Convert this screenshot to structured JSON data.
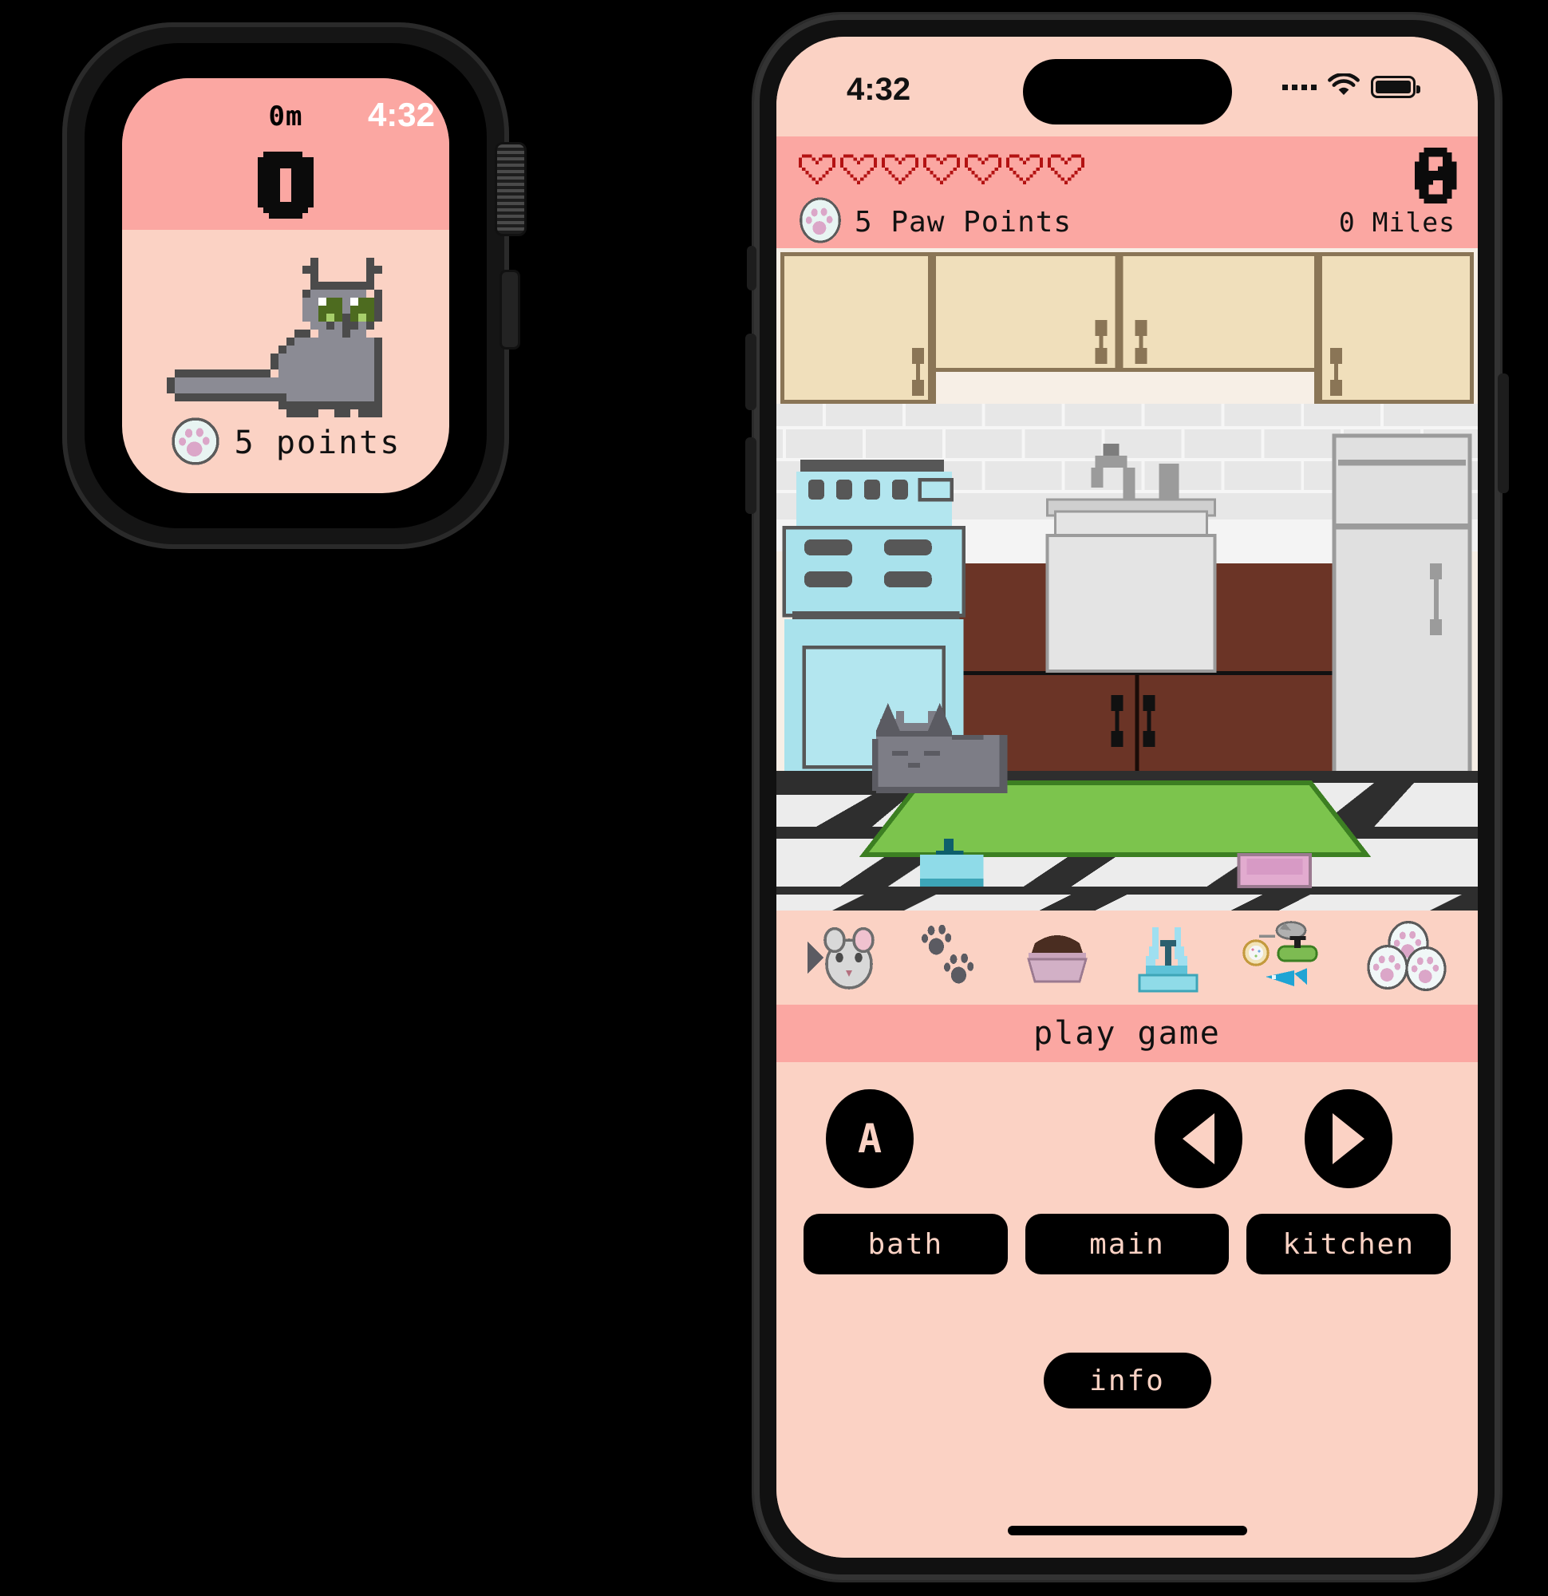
{
  "app": {
    "accent_pink": "#fba7a2",
    "bg_pink": "#fbd2c4",
    "heart_color": "#b31212",
    "ink": "#111111"
  },
  "watch": {
    "steps": "0m",
    "time": "4:32",
    "badge_icon": "zero-badge-icon",
    "pet_icon": "grey-cat-sitting-icon",
    "coin_icon": "paw-coin-icon",
    "points_label": "5 points"
  },
  "phone": {
    "statusbar": {
      "time": "4:32",
      "cellular_icon": "cellular-dots-icon",
      "wifi_icon": "wifi-icon",
      "battery_icon": "battery-icon"
    },
    "hud": {
      "hearts_total": 7,
      "hearts_filled": 0,
      "heart_icon": "heart-outline-icon",
      "coin_icon": "paw-coin-icon",
      "paw_points": "5 Paw Points",
      "miles": "0 Miles",
      "settings_icon": "pixel-settings-icon"
    },
    "scene": {
      "room": "kitchen",
      "pet_icon": "grey-cat-lying-icon",
      "objects": [
        "upper-cabinets",
        "tile-backsplash",
        "stove",
        "sink",
        "counter",
        "fridge",
        "green-rug",
        "water-fountain",
        "pet-bed",
        "checker-floor"
      ]
    },
    "itembar": [
      {
        "name": "mouse-toy-item",
        "label": "mouse toy"
      },
      {
        "name": "paw-prints-item",
        "label": "paw prints"
      },
      {
        "name": "food-bowl-item",
        "label": "food bowl"
      },
      {
        "name": "water-fountain-item",
        "label": "water fountain"
      },
      {
        "name": "treats-item",
        "label": "treats"
      },
      {
        "name": "paw-coins-item",
        "label": "paw coins"
      }
    ],
    "playbar": {
      "label": "play game"
    },
    "controls": {
      "action_label": "A",
      "left_icon": "arrow-left-icon",
      "right_icon": "arrow-right-icon"
    },
    "rooms": [
      {
        "name": "bath",
        "label": "bath"
      },
      {
        "name": "main",
        "label": "main"
      },
      {
        "name": "kitchen",
        "label": "kitchen"
      }
    ],
    "info": {
      "label": "info"
    }
  }
}
